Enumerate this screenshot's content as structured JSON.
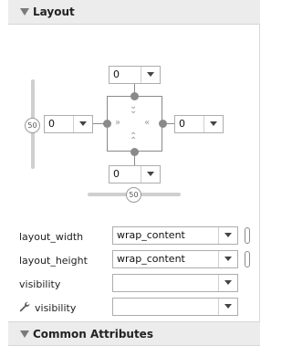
{
  "sections": {
    "layout": "Layout",
    "common_attributes": "Common Attributes"
  },
  "margins": {
    "top": "0",
    "left": "0",
    "right": "0",
    "bottom": "0"
  },
  "sliders": {
    "vertical_bias": "50",
    "horizontal_bias": "50"
  },
  "attributes": [
    {
      "label": "layout_width",
      "value": "wrap_content"
    },
    {
      "label": "layout_height",
      "value": "wrap_content"
    },
    {
      "label": "visibility",
      "value": ""
    },
    {
      "label": "visibility",
      "value": ""
    }
  ]
}
